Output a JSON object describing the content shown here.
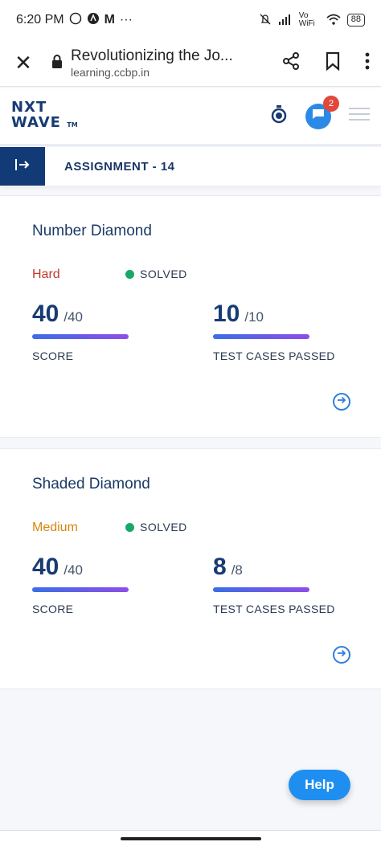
{
  "status_bar": {
    "time": "6:20 PM",
    "icons": [
      "whatsapp-icon",
      "app-icon",
      "m-icon",
      "more-dots"
    ],
    "network": "Vo WiFi",
    "battery": "88"
  },
  "browser": {
    "title": "Revolutionizing the Jo...",
    "domain": "learning.ccbp.in"
  },
  "header": {
    "logo_line1": "NXT",
    "logo_line2": "WAVE",
    "logo_tm": "TM",
    "notification_count": "2"
  },
  "assignment": {
    "title": "ASSIGNMENT - 14"
  },
  "questions": [
    {
      "title": "Number Diamond",
      "difficulty": "Hard",
      "difficulty_color": "#c0392b",
      "status": "SOLVED",
      "score": "40",
      "score_total": "/40",
      "score_label": "SCORE",
      "tests": "10",
      "tests_total": "/10",
      "tests_label": "TEST CASES PASSED"
    },
    {
      "title": "Shaded Diamond",
      "difficulty": "Medium",
      "difficulty_color": "#d4880e",
      "status": "SOLVED",
      "score": "40",
      "score_total": "/40",
      "score_label": "SCORE",
      "tests": "8",
      "tests_total": "/8",
      "tests_label": "TEST CASES PASSED"
    }
  ],
  "help": {
    "label": "Help"
  }
}
